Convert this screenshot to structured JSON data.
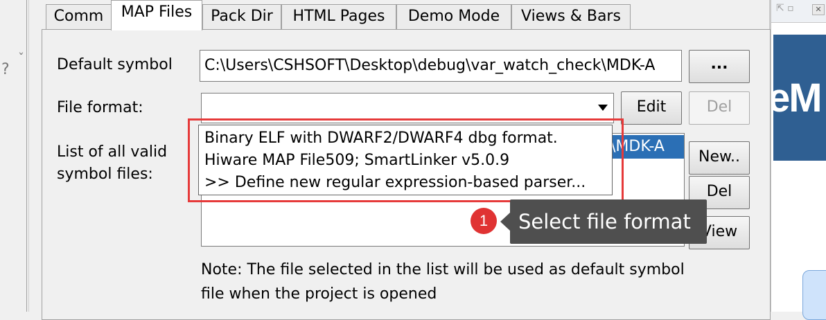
{
  "left_strip": {
    "glyph_question": "?",
    "glyph_mark": "ˇ"
  },
  "tabs": [
    {
      "label": "Comm",
      "active": false
    },
    {
      "label": "MAP Files",
      "active": true
    },
    {
      "label": "Pack Dir",
      "active": false
    },
    {
      "label": "HTML Pages",
      "active": false
    },
    {
      "label": "Demo Mode",
      "active": false
    },
    {
      "label": "Views & Bars",
      "active": false
    }
  ],
  "default_symbol": {
    "label": "Default symbol",
    "value": "C:\\Users\\CSHSOFT\\Desktop\\debug\\var_watch_check\\MDK-A",
    "browse_label": "..."
  },
  "file_format": {
    "label": "File format:",
    "value": "",
    "edit_label": "Edit",
    "del_label": "Del"
  },
  "symbol_files": {
    "label_line1": "List of all valid",
    "label_line2": "symbol files:",
    "selected_item_text": "\\MDK-A",
    "new_label": "New..",
    "del_label": "Del",
    "view_label": "View"
  },
  "dropdown": {
    "options": [
      "Binary ELF with DWARF2/DWARF4 dbg format.",
      "Hiware MAP File509; SmartLinker v5.0.9",
      ">> Define new regular expression-based parser..."
    ]
  },
  "annotation": {
    "step_number": "1",
    "tooltip_text": "Select file format",
    "highlight_color": "#e63a3a"
  },
  "note": {
    "line1": "Note: The file selected in the list will be used as default symbol",
    "line2": "file when the project is opened"
  },
  "background_window": {
    "title_fragment": "eM"
  },
  "colors": {
    "selection": "#2b6fb5",
    "badge": "#e03333",
    "tooltip_bg": "#4f4f4f",
    "bg_window_blue": "#2f5f92"
  }
}
